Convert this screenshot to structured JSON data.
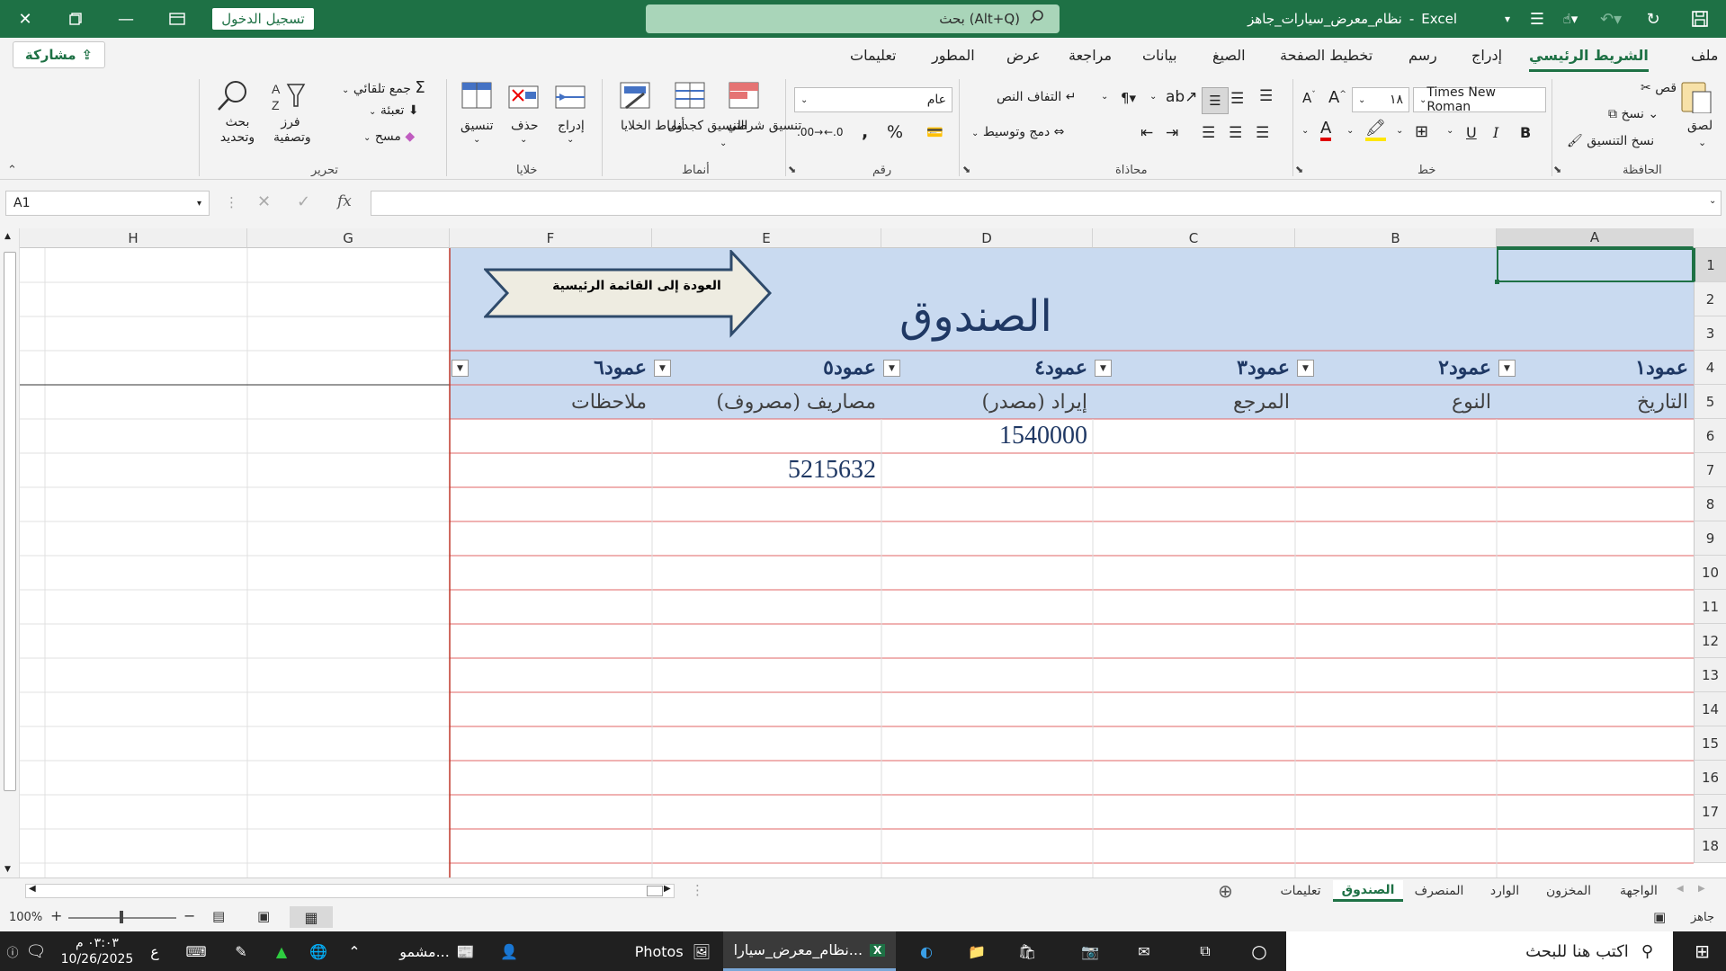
{
  "titlebar": {
    "sign_in": "تسجيل الدخول",
    "search_placeholder": "بحث (Alt+Q)",
    "app_name": "Excel",
    "file_name": "نظام_معرض_سيارات_جاهز",
    "accent": "#1e7145"
  },
  "menu": {
    "share": "مشاركة",
    "tabs": [
      "ملف",
      "الشريط الرئيسي",
      "إدراج",
      "رسم",
      "تخطيط الصفحة",
      "الصيغ",
      "بيانات",
      "مراجعة",
      "عرض",
      "المطور",
      "تعليمات"
    ],
    "active_tab": "الشريط الرئيسي"
  },
  "ribbon": {
    "clipboard": {
      "label": "الحافظة",
      "paste": "لصق",
      "cut": "قص",
      "copy": "نسخ",
      "format_painter": "نسخ التنسيق"
    },
    "font": {
      "label": "خط",
      "name": "Times New Roman",
      "size": "١٨",
      "bold": "B",
      "italic": "I",
      "underline": "U",
      "grow": "A",
      "shrink": "A"
    },
    "alignment": {
      "label": "محاذاة",
      "wrap": "التفاف النص",
      "merge": "دمج وتوسيط"
    },
    "number": {
      "label": "رقم",
      "format": "عام"
    },
    "styles": {
      "label": "أنماط",
      "conditional": "تنسيق شرطي",
      "table": "التنسيق كجدول",
      "cell_styles": "أنماط الخلايا"
    },
    "cells": {
      "label": "خلايا",
      "insert": "إدراج",
      "delete": "حذف",
      "format": "تنسيق"
    },
    "editing": {
      "label": "تحرير",
      "autosum": "جمع تلقائي",
      "fill": "تعبئة",
      "clear": "مسح",
      "sort": "فرز وتصفية",
      "find": "بحث وتحديد"
    }
  },
  "formula_bar": {
    "name_box": "A1",
    "fx": "fx",
    "value": ""
  },
  "sheet": {
    "columns": [
      "A",
      "B",
      "C",
      "D",
      "E",
      "F",
      "G",
      "H"
    ],
    "rows": [
      "1",
      "2",
      "3",
      "4",
      "5",
      "6",
      "7",
      "8",
      "9",
      "10",
      "11",
      "12",
      "13",
      "14",
      "15",
      "16",
      "17",
      "18"
    ],
    "title": "الصندوق",
    "back_button": "العودة إلى القائمة الرئيسية",
    "headers": [
      "عمود١",
      "عمود٢",
      "عمود٣",
      "عمود٤",
      "عمود٥",
      "عمود٦"
    ],
    "labels": [
      "التاريخ",
      "النوع",
      "المرجع",
      "إيراد (مصدر)",
      "مصاريف (مصروف)",
      "ملاحظات"
    ],
    "values": {
      "D6": "1540000",
      "E7": "5215632"
    },
    "band_color": "#c9daf0",
    "line_color": "#e06666"
  },
  "sheet_tabs": {
    "tabs": [
      "الواجهة",
      "المخزون",
      "الوارد",
      "المنصرف",
      "الصندوق",
      "تعليمات"
    ],
    "active": "الصندوق"
  },
  "status": {
    "ready": "جاهز",
    "zoom": "100%"
  },
  "taskbar": {
    "search": "اكتب هنا للبحث",
    "photos": "Photos",
    "excel_window": "نظام_معرض_سيارا...",
    "shared": "مشمو...",
    "time": "٠٣:٠٣ م",
    "date": "10/26/2025",
    "lang": "ع"
  }
}
